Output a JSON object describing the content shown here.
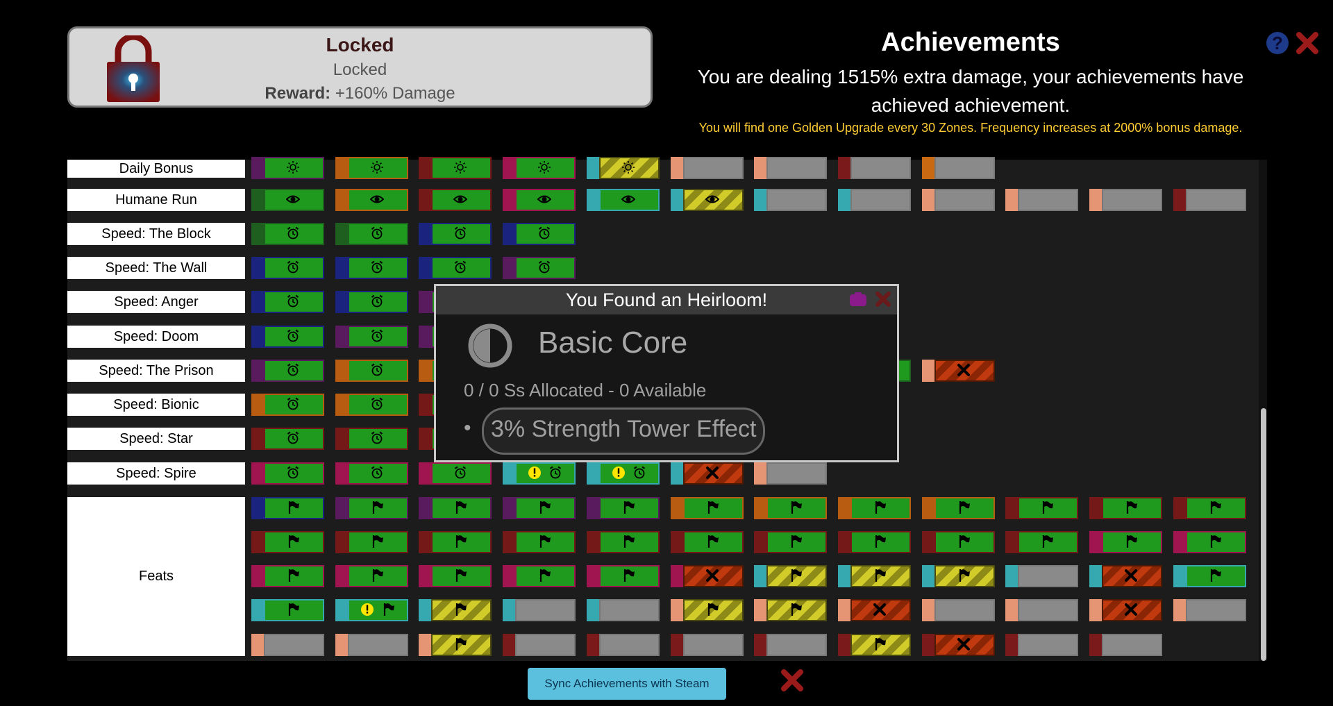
{
  "locked_panel": {
    "title": "Locked",
    "subtitle": "Locked",
    "reward_label": "Reward:",
    "reward_value": "+160% Damage"
  },
  "achievements": {
    "title": "Achievements",
    "description": "You are dealing 1515% extra damage, your achievements have achieved achievement.",
    "golden_note": "You will find one Golden Upgrade every 30 Zones. Frequency increases at 2000% bonus damage.",
    "help_icon": "?"
  },
  "rows": [
    {
      "label": "Daily Bonus",
      "icon": "sun-icon",
      "tiles": [
        {
          "accent": "#5a1a5e",
          "state": "green"
        },
        {
          "accent": "#b85c12",
          "state": "green"
        },
        {
          "accent": "#741818",
          "state": "green"
        },
        {
          "accent": "#a0144f",
          "state": "green"
        },
        {
          "accent": "#36a8b0",
          "state": "yellow"
        },
        {
          "accent": "#e59474",
          "state": "gray"
        },
        {
          "accent": "#e59474",
          "state": "gray"
        },
        {
          "accent": "#7a1a1a",
          "state": "gray"
        },
        {
          "accent": "#c96a12",
          "state": "gray"
        }
      ]
    },
    {
      "label": "Humane Run",
      "icon": "eye-icon",
      "tiles": [
        {
          "accent": "#1e5e1e",
          "state": "green"
        },
        {
          "accent": "#b85c12",
          "state": "green"
        },
        {
          "accent": "#741818",
          "state": "green"
        },
        {
          "accent": "#a0144f",
          "state": "green"
        },
        {
          "accent": "#36a8b0",
          "state": "green"
        },
        {
          "accent": "#36a8b0",
          "state": "yellow"
        },
        {
          "accent": "#36a8b0",
          "state": "gray"
        },
        {
          "accent": "#36a8b0",
          "state": "gray"
        },
        {
          "accent": "#e59474",
          "state": "gray"
        },
        {
          "accent": "#e59474",
          "state": "gray"
        },
        {
          "accent": "#e59474",
          "state": "gray"
        },
        {
          "accent": "#7a1a1a",
          "state": "gray"
        }
      ]
    },
    {
      "label": "Speed: The Block",
      "icon": "clock-icon",
      "tiles": [
        {
          "accent": "#1e5e1e",
          "state": "green"
        },
        {
          "accent": "#1e5e1e",
          "state": "green"
        },
        {
          "accent": "#1a237e",
          "state": "green"
        },
        {
          "accent": "#1a237e",
          "state": "green"
        }
      ]
    },
    {
      "label": "Speed: The Wall",
      "icon": "clock-icon",
      "tiles": [
        {
          "accent": "#1a237e",
          "state": "green"
        },
        {
          "accent": "#1a237e",
          "state": "green"
        },
        {
          "accent": "#1a237e",
          "state": "green"
        },
        {
          "accent": "#5a1a5e",
          "state": "green"
        }
      ]
    },
    {
      "label": "Speed: Anger",
      "icon": "clock-icon",
      "tiles": [
        {
          "accent": "#1a237e",
          "state": "green"
        },
        {
          "accent": "#1a237e",
          "state": "green"
        },
        {
          "accent": "#5a1a5e",
          "state": "green"
        }
      ]
    },
    {
      "label": "Speed: Doom",
      "icon": "clock-icon",
      "tiles": [
        {
          "accent": "#1a237e",
          "state": "green"
        },
        {
          "accent": "#5a1a5e",
          "state": "green"
        },
        {
          "accent": "#5a1a5e",
          "state": "green"
        }
      ]
    },
    {
      "label": "Speed: The Prison",
      "icon": "clock-icon",
      "tiles": [
        {
          "accent": "#5a1a5e",
          "state": "green"
        },
        {
          "accent": "#b85c12",
          "state": "green"
        },
        {
          "accent": "#b85c12",
          "state": "green"
        },
        null,
        null,
        null,
        null,
        {
          "accent": "#1e5e1e",
          "state": "green"
        },
        {
          "accent": "#e59474",
          "state": "red"
        }
      ]
    },
    {
      "label": "Speed: Bionic",
      "icon": "clock-icon",
      "tiles": [
        {
          "accent": "#b85c12",
          "state": "green"
        },
        {
          "accent": "#b85c12",
          "state": "green"
        },
        {
          "accent": "#741818",
          "state": "green"
        }
      ]
    },
    {
      "label": "Speed: Star",
      "icon": "clock-icon",
      "tiles": [
        {
          "accent": "#741818",
          "state": "green"
        },
        {
          "accent": "#741818",
          "state": "green"
        },
        {
          "accent": "#741818",
          "state": "green"
        }
      ]
    },
    {
      "label": "Speed: Spire",
      "icon": "clock-icon",
      "tiles": [
        {
          "accent": "#a0144f",
          "state": "green"
        },
        {
          "accent": "#a0144f",
          "state": "green"
        },
        {
          "accent": "#a0144f",
          "state": "green"
        },
        {
          "accent": "#36a8b0",
          "state": "green",
          "alert": true
        },
        {
          "accent": "#36a8b0",
          "state": "green",
          "alert": true
        },
        {
          "accent": "#36a8b0",
          "state": "red"
        },
        {
          "accent": "#e59474",
          "state": "gray"
        }
      ]
    }
  ],
  "feats": {
    "label": "Feats",
    "icon": "flag-icon",
    "rows": [
      [
        {
          "accent": "#1a237e",
          "state": "green"
        },
        {
          "accent": "#5a1a5e",
          "state": "green"
        },
        {
          "accent": "#5a1a5e",
          "state": "green"
        },
        {
          "accent": "#5a1a5e",
          "state": "green"
        },
        {
          "accent": "#5a1a5e",
          "state": "green"
        },
        {
          "accent": "#b85c12",
          "state": "green"
        },
        {
          "accent": "#b85c12",
          "state": "green"
        },
        {
          "accent": "#b85c12",
          "state": "green"
        },
        {
          "accent": "#b85c12",
          "state": "green"
        },
        {
          "accent": "#741818",
          "state": "green"
        },
        {
          "accent": "#741818",
          "state": "green"
        },
        {
          "accent": "#741818",
          "state": "green"
        }
      ],
      [
        {
          "accent": "#741818",
          "state": "green"
        },
        {
          "accent": "#741818",
          "state": "green"
        },
        {
          "accent": "#741818",
          "state": "green"
        },
        {
          "accent": "#741818",
          "state": "green"
        },
        {
          "accent": "#741818",
          "state": "green"
        },
        {
          "accent": "#741818",
          "state": "green"
        },
        {
          "accent": "#741818",
          "state": "green"
        },
        {
          "accent": "#741818",
          "state": "green"
        },
        {
          "accent": "#741818",
          "state": "green"
        },
        {
          "accent": "#741818",
          "state": "green"
        },
        {
          "accent": "#a0144f",
          "state": "green"
        },
        {
          "accent": "#a0144f",
          "state": "green"
        }
      ],
      [
        {
          "accent": "#a0144f",
          "state": "green"
        },
        {
          "accent": "#a0144f",
          "state": "green"
        },
        {
          "accent": "#a0144f",
          "state": "green"
        },
        {
          "accent": "#a0144f",
          "state": "green"
        },
        {
          "accent": "#a0144f",
          "state": "green"
        },
        {
          "accent": "#a0144f",
          "state": "red"
        },
        {
          "accent": "#36a8b0",
          "state": "yellow"
        },
        {
          "accent": "#36a8b0",
          "state": "yellow"
        },
        {
          "accent": "#36a8b0",
          "state": "yellow"
        },
        {
          "accent": "#36a8b0",
          "state": "gray"
        },
        {
          "accent": "#36a8b0",
          "state": "red"
        },
        {
          "accent": "#36a8b0",
          "state": "green"
        }
      ],
      [
        {
          "accent": "#36a8b0",
          "state": "green"
        },
        {
          "accent": "#36a8b0",
          "state": "green",
          "alert": true
        },
        {
          "accent": "#36a8b0",
          "state": "yellow"
        },
        {
          "accent": "#36a8b0",
          "state": "gray"
        },
        {
          "accent": "#36a8b0",
          "state": "gray"
        },
        {
          "accent": "#e59474",
          "state": "yellow"
        },
        {
          "accent": "#e59474",
          "state": "yellow"
        },
        {
          "accent": "#e59474",
          "state": "red"
        },
        {
          "accent": "#e59474",
          "state": "gray"
        },
        {
          "accent": "#e59474",
          "state": "gray"
        },
        {
          "accent": "#e59474",
          "state": "red"
        },
        {
          "accent": "#e59474",
          "state": "gray"
        }
      ],
      [
        {
          "accent": "#e59474",
          "state": "gray"
        },
        {
          "accent": "#e59474",
          "state": "gray"
        },
        {
          "accent": "#e59474",
          "state": "yellow"
        },
        {
          "accent": "#7a1a1a",
          "state": "gray"
        },
        {
          "accent": "#7a1a1a",
          "state": "gray"
        },
        {
          "accent": "#7a1a1a",
          "state": "gray"
        },
        {
          "accent": "#7a1a1a",
          "state": "gray"
        },
        {
          "accent": "#7a1a1a",
          "state": "yellow"
        },
        {
          "accent": "#7a1a1a",
          "state": "red"
        },
        {
          "accent": "#7a1a1a",
          "state": "gray"
        },
        {
          "accent": "#7a1a1a",
          "state": "gray"
        }
      ]
    ]
  },
  "popup": {
    "title": "You Found an Heirloom!",
    "item_name": "Basic Core",
    "allocation": "0 / 0 Ss Allocated - 0 Available",
    "bullet": "•",
    "modifier": "3% Strength Tower Effect"
  },
  "sync_button": "Sync Achievements with Steam",
  "colors": {
    "green": "#1f9a1f",
    "gray": "#8a8a8a",
    "red_x": "#9b1b1b",
    "steam_button": "#5bc0de"
  }
}
